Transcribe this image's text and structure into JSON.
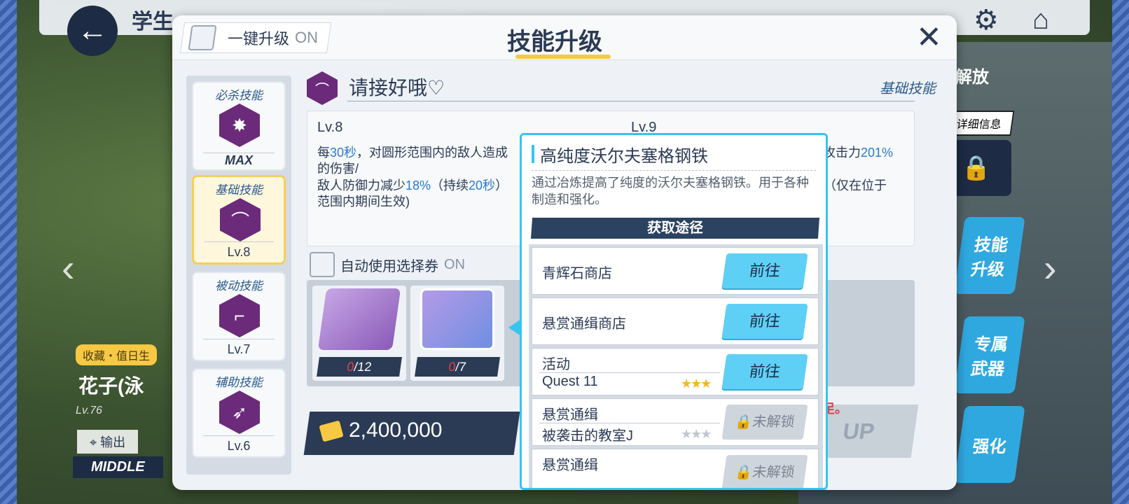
{
  "topbar": {
    "title": "学生"
  },
  "left_char": {
    "fav": "收藏・值日生",
    "name": "花子(泳",
    "level": "Lv.76",
    "role": "输出",
    "position": "MIDDLE"
  },
  "right_menu": {
    "unlock": "解放",
    "detail": "详细信息",
    "items": [
      "技能\n升级",
      "专属\n武器",
      "强化"
    ]
  },
  "panel": {
    "onekey_label": "一键升级",
    "onekey_state": "ON",
    "title": "技能升级"
  },
  "skills": [
    {
      "type": "必杀技能",
      "level": "MAX"
    },
    {
      "type": "基础技能",
      "level": "Lv.8"
    },
    {
      "type": "被动技能",
      "level": "Lv.7"
    },
    {
      "type": "辅助技能",
      "level": "Lv.6"
    }
  ],
  "detail": {
    "name": "请接好哦♡",
    "category": "基础技能",
    "lv_current": "Lv.8",
    "lv_next": "Lv.9",
    "desc_cur_parts": [
      "每",
      "30秒",
      "，对圆形范围内的敌人造成",
      "的伤害/",
      "敌人防御力减少",
      "18%",
      "（持续",
      "20秒",
      "）"
    ],
    "desc_cur_tail": "范围内期间生效)",
    "desc_next_a": "造成攻击力",
    "desc_next_pct": "201%",
    "desc_next_b": "0秒）（仅在位于",
    "auto_label": "自动使用选择券",
    "auto_state": "ON"
  },
  "materials": [
    {
      "have": "0",
      "need": "/12"
    },
    {
      "have": "0",
      "need": "/7"
    }
  ],
  "cost": {
    "value": "2,400,000",
    "warning": "不足。",
    "button": "UP"
  },
  "popup": {
    "title": "高纯度沃尔夫塞格钢铁",
    "description": "通过冶炼提高了纯度的沃尔夫塞格钢铁。用于各种制造和强化。",
    "source_header": "获取途径",
    "sources": [
      {
        "name": "青辉石商店",
        "sub": "",
        "stars": 0,
        "button": "前往",
        "locked": false
      },
      {
        "name": "悬赏通缉商店",
        "sub": "",
        "stars": 0,
        "button": "前往",
        "locked": false
      },
      {
        "name": "活动",
        "sub": "Quest 11",
        "stars": 3,
        "button": "前往",
        "locked": false
      },
      {
        "name": "悬赏通缉",
        "sub": "被袭击的教室J",
        "stars": 0,
        "button": "未解锁",
        "locked": true
      },
      {
        "name": "悬赏通缉",
        "sub": "",
        "stars": 0,
        "button": "未解锁",
        "locked": true
      }
    ]
  }
}
